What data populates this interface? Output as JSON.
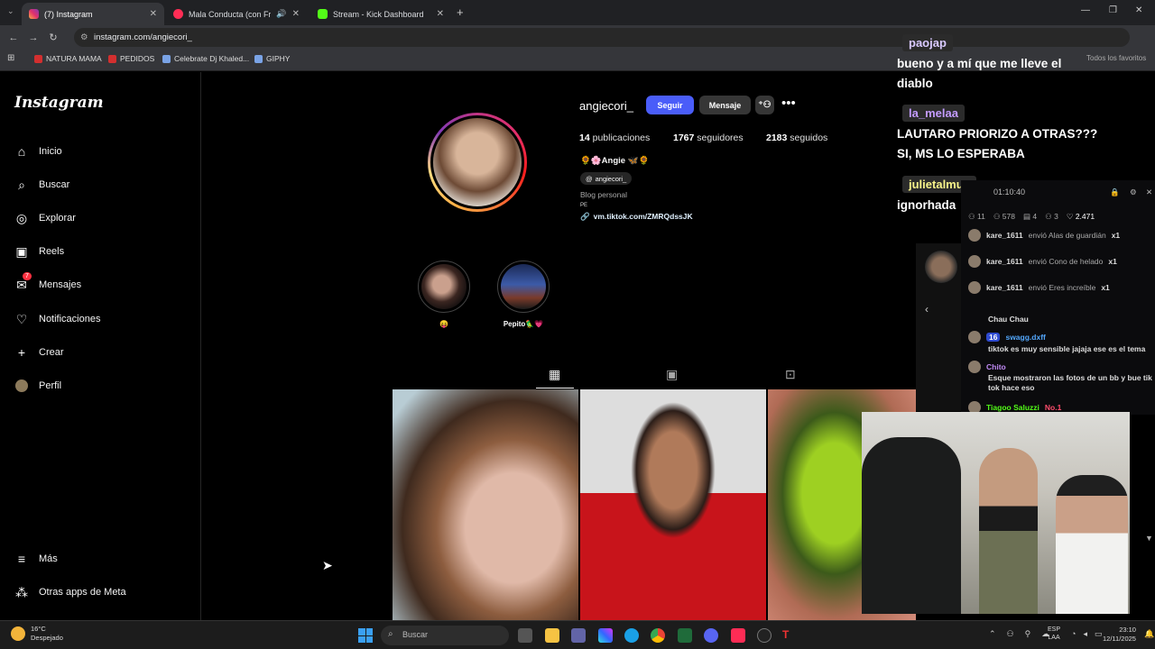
{
  "browser": {
    "tabs": [
      {
        "label": "(7) Instagram",
        "active": true
      },
      {
        "label": "Mala Conducta (con Franco",
        "active": false
      },
      {
        "label": "Stream - Kick Dashboard",
        "active": false
      }
    ],
    "url": "instagram.com/angiecori_",
    "bookmarks": [
      "NATURA MAMA",
      "PEDIDOS",
      "Celebrate Dj Khaled...",
      "GIPHY"
    ],
    "all_bookmarks": "Todos los favoritos"
  },
  "sidebar": {
    "logo": "Instagram",
    "items": [
      {
        "label": "Inicio",
        "icon": "home-icon"
      },
      {
        "label": "Buscar",
        "icon": "search-icon"
      },
      {
        "label": "Explorar",
        "icon": "compass-icon"
      },
      {
        "label": "Reels",
        "icon": "reels-icon"
      },
      {
        "label": "Mensajes",
        "icon": "messenger-icon",
        "badge": "7"
      },
      {
        "label": "Notificaciones",
        "icon": "heart-icon"
      },
      {
        "label": "Crear",
        "icon": "plus-icon"
      },
      {
        "label": "Perfil",
        "icon": "avatar-icon"
      }
    ],
    "more": "Más",
    "meta_apps": "Otras apps de Meta"
  },
  "profile": {
    "username": "angiecori_",
    "follow": "Seguir",
    "message": "Mensaje",
    "posts_count": "14",
    "posts_label": "publicaciones",
    "followers_count": "1767",
    "followers_label": "seguidores",
    "following_count": "2183",
    "following_label": "seguidos",
    "display_name": "🌻🌸Angie 🦋🌻",
    "threads_handle": "angiecori_",
    "category": "Blog personal",
    "pe": "PE",
    "link": "vm.tiktok.com/ZMRQdssJK",
    "highlights": [
      {
        "label": "😝"
      },
      {
        "label": "Pepito🦜💗"
      }
    ]
  },
  "stream_chat": {
    "messages": [
      {
        "user": "paojap",
        "color": "#d9c9ff",
        "text": "bueno y a mí que me lleve el diablo"
      },
      {
        "user": "la_melaa",
        "color": "#c39bff",
        "text": "LAUTARO PRIORIZO A OTRAS??? SI, MS LO ESPERABA"
      },
      {
        "user": "julietalmua",
        "color": "#f6f28a",
        "text": "ignorhada"
      }
    ]
  },
  "kick_panel": {
    "timer": "01:10:40",
    "stats": [
      "11",
      "578",
      "4",
      "3",
      "2.471"
    ],
    "gifts": [
      {
        "user": "kare_1611",
        "text": "envió Alas de guardián",
        "count": "x1"
      },
      {
        "user": "kare_1611",
        "text": "envió Cono de helado",
        "count": "x1"
      },
      {
        "user": "kare_1611",
        "text": "envió Eres increíble",
        "count": "x1"
      }
    ],
    "chat": [
      {
        "user": "",
        "text": "Chau Chau"
      },
      {
        "user": "swagg.dxff",
        "badge": "16",
        "text": "tiktok es muy sensible jajaja ese es el tema"
      },
      {
        "user": "Chito",
        "text": "Esque mostraron las fotos de un bb y bue tik tok hace eso"
      },
      {
        "user": "Tiagoo Saluzzi",
        "badge": "No.1",
        "text": ""
      }
    ]
  },
  "taskbar": {
    "temperature": "16°C",
    "weather": "Despejado",
    "search": "Buscar",
    "lang_top": "ESP",
    "lang_bottom": "LAA",
    "time": "23:10",
    "date": "12/11/2025"
  },
  "colors": {
    "follow_button": "#4a5df9",
    "secondary_button": "#363636",
    "kick_green": "#53fc18"
  }
}
